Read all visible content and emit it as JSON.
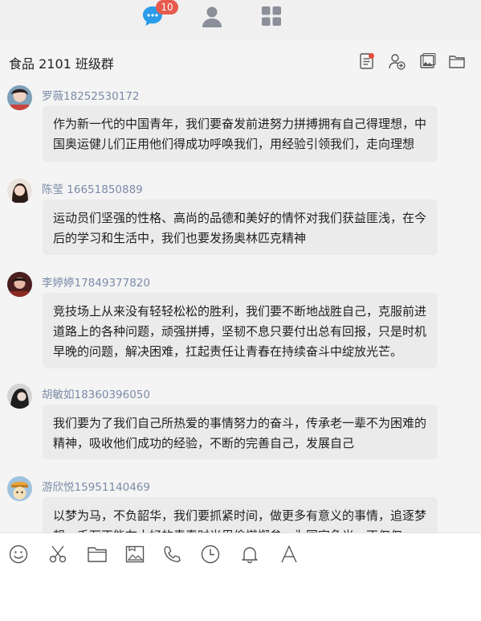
{
  "nav": {
    "unread_badge": "10",
    "icons": [
      "chat-bubble-icon",
      "contacts-icon",
      "apps-grid-icon"
    ]
  },
  "chat": {
    "title": "食品 2101 班级群"
  },
  "header_icons": [
    "group-notice-icon",
    "add-member-icon",
    "image-icon",
    "folder-icon"
  ],
  "messages": [
    {
      "sender": "罗薇18252530172",
      "text": "作为新一代的中国青年，我们要奋发前进努力拼搏拥有自己得理想，中国奥运健儿们正用他们得成功呼唤我们，用经验引领我们，走向理想"
    },
    {
      "sender": "陈莹 16651850889",
      "text": "运动员们坚强的性格、高尚的品德和美好的情怀对我们获益匪浅，在今后的学习和生活中，我们也要发扬奥林匹克精神"
    },
    {
      "sender": "李婷婷17849377820",
      "text": "竞技场上从来没有轻轻松松的胜利，我们要不断地战胜自己，克服前进道路上的各种问题，顽强拼搏，坚韧不息只要付出总有回报，只是时机早晚的问题，解决困难，扛起责任让青春在持续奋斗中绽放光芒。"
    },
    {
      "sender": "胡敏如18360396050",
      "text": "我们要为了我们自己所热爱的事情努力的奋斗，传承老一辈不为困难的精神，吸收他们成功的经验，不断的完善自己，发展自己"
    },
    {
      "sender": "游欣悦15951140469",
      "text": "以梦为马，不负韶华，我们要抓紧时间，做更多有意义的事情，追逐梦想，千万不能在大好的青春时光里偷懒懈怠，为国家争光，不仅仅"
    }
  ],
  "toolbar_icons": [
    "emoji-icon",
    "scissors-icon",
    "folder-icon",
    "image-gallery-icon",
    "phone-icon",
    "clock-icon",
    "bell-icon",
    "font-icon"
  ]
}
